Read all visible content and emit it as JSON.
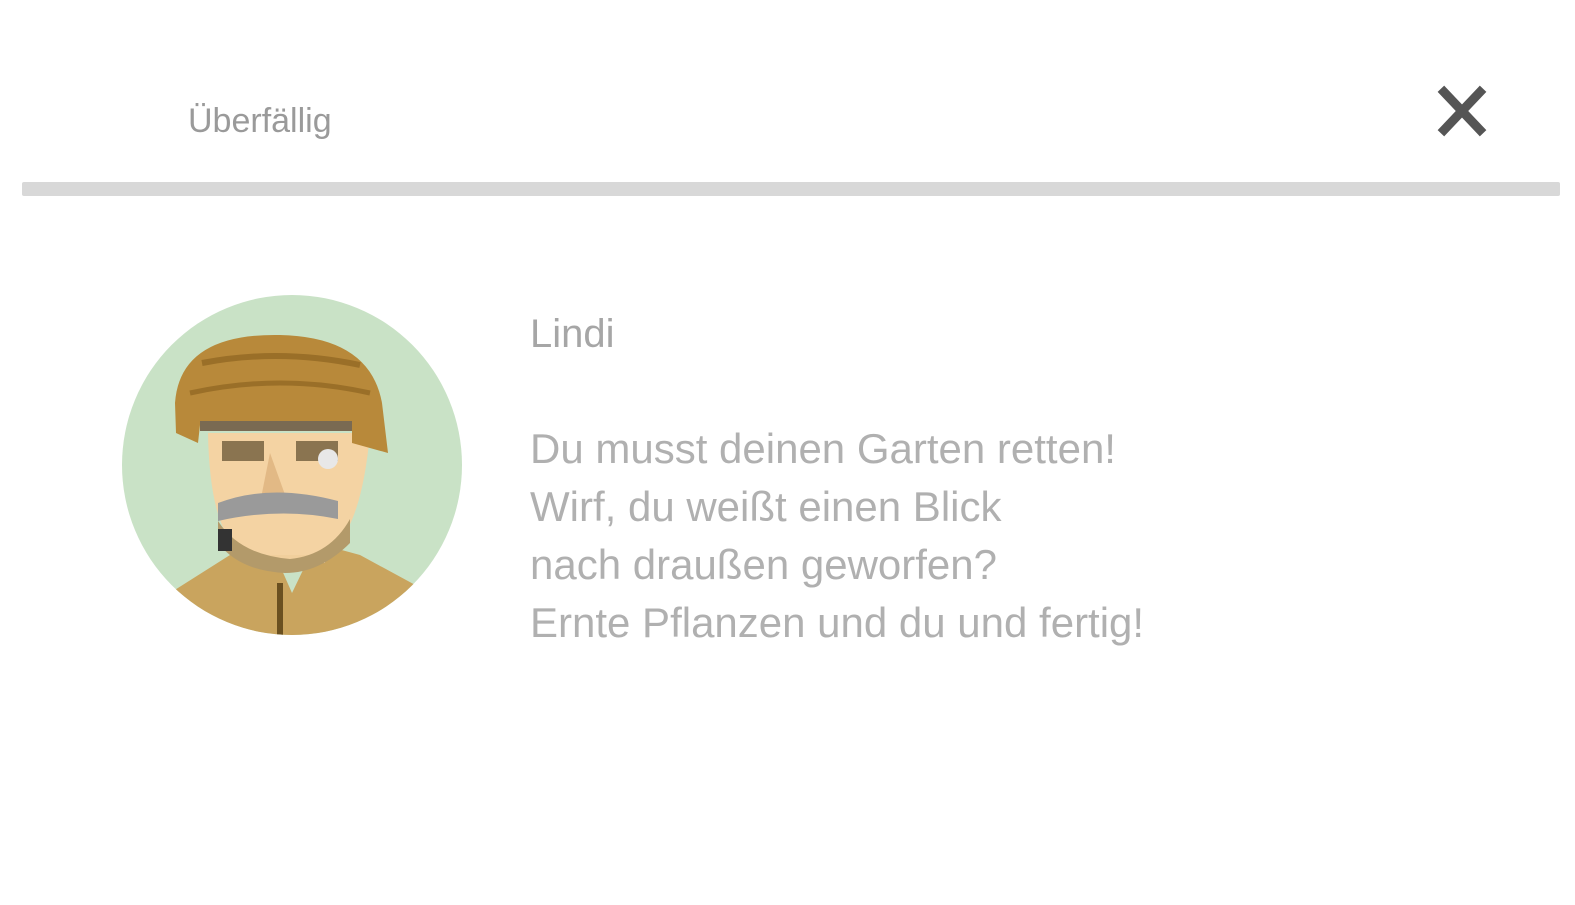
{
  "dialog": {
    "title": "Überfällig",
    "close_icon": "close-icon",
    "close_label": "X"
  },
  "speaker": {
    "name": "Lindi",
    "avatar_icon": "farmer-portrait-icon"
  },
  "message": {
    "lines": [
      "Du musst deinen Garten retten!",
      "Wirf, du weißt einen Blick",
      "nach draußen geworfen?",
      "Ernte Pflanzen und du und fertig!"
    ]
  },
  "colors": {
    "divider": "#d8d8d8",
    "avatar_bg": "#c9e2c6",
    "hat": "#b8893a",
    "coat": "#c9a45e",
    "text": "#a6a6a6"
  }
}
